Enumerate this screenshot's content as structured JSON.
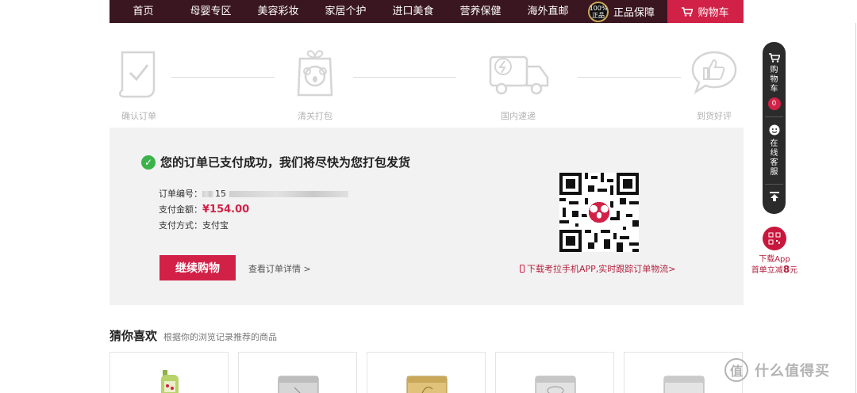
{
  "nav": {
    "items": [
      "首页",
      "母婴专区",
      "美容彩妆",
      "家居个护",
      "进口美食",
      "营养保健",
      "海外直邮"
    ],
    "badge_line1": "100%",
    "badge_line2": "正品",
    "guarantee_label": "正品保障",
    "cart_label": "购物车"
  },
  "steps": [
    {
      "label": "确认订单",
      "icon": "document-check-icon"
    },
    {
      "label": "清关打包",
      "icon": "koala-package-icon"
    },
    {
      "label": "国内速递",
      "icon": "delivery-truck-icon"
    },
    {
      "label": "到货好评",
      "icon": "thumbs-up-bubble-icon"
    }
  ],
  "order": {
    "success_message": "您的订单已支付成功，我们将尽快为您打包发货",
    "order_number_label": "订单编号：",
    "order_number_visible": "15",
    "amount_label": "支付金额：",
    "amount_value": "¥154.00",
    "method_label": "支付方式：",
    "method_value": "支付宝",
    "continue_button": "继续购物",
    "detail_link": "查看订单详情 >",
    "app_link": "下载考拉手机APP,实时跟踪订单物流>"
  },
  "recommend": {
    "title": "猜你喜欢",
    "subtitle": "根据你的浏览记录推荐的商品"
  },
  "sidebar": {
    "cart_text": "购物车",
    "cart_count": "0",
    "service_text": "在线客服",
    "app_promo_line1": "下载App",
    "app_promo_line2_prefix": "首单立减",
    "app_promo_amount": "8",
    "app_promo_unit": "元"
  },
  "watermark": {
    "symbol": "值",
    "text": "什么值得买"
  },
  "colors": {
    "brand_red": "#d22147",
    "nav_bg": "#3a1620",
    "success_green": "#3bb34a"
  }
}
